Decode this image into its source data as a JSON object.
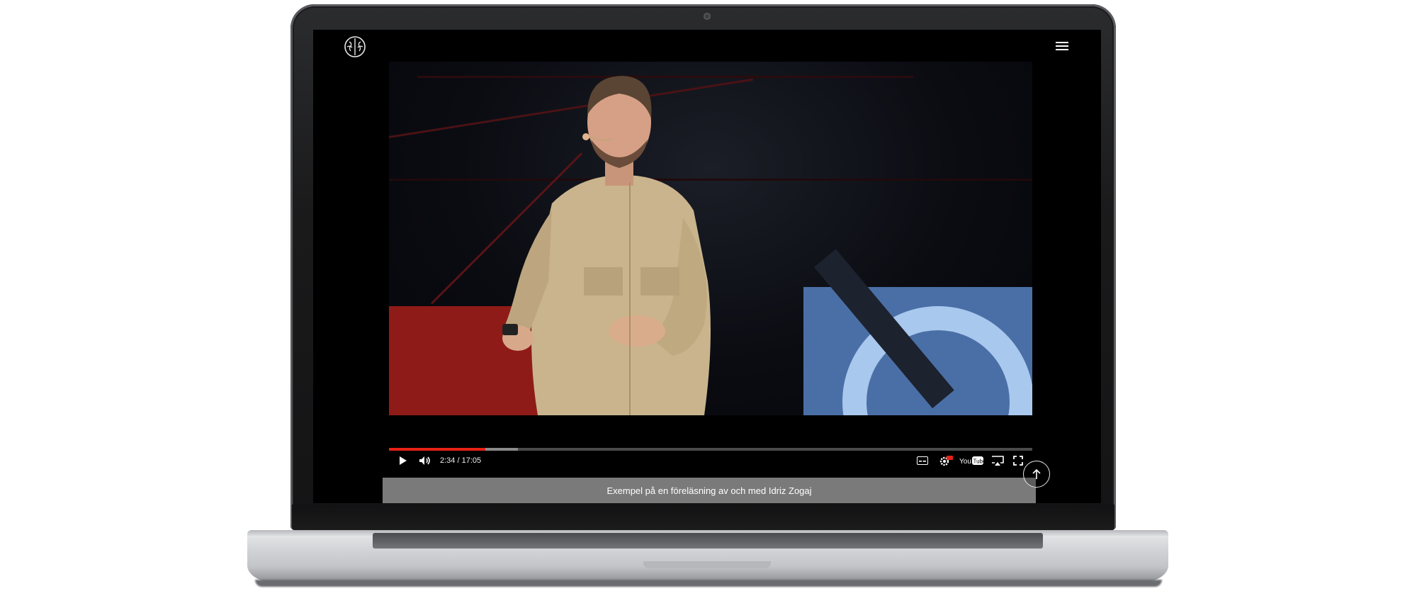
{
  "player": {
    "current_time": "2:34",
    "duration": "17:05",
    "time_display": "2:34 / 17:05",
    "progress_fraction": 0.15,
    "buffered_fraction": 0.2,
    "youtube_label": "YouTube"
  },
  "caption": {
    "text": "Exempel på en föreläsning av och med Idriz Zogaj"
  },
  "icons": {
    "logo": "brain-icon",
    "menu": "hamburger-menu-icon",
    "play": "play-icon",
    "volume": "volume-icon",
    "subtitles": "subtitles-icon",
    "settings": "settings-gear-icon",
    "youtube": "youtube-logo-icon",
    "airplay": "airplay-icon",
    "fullscreen": "fullscreen-icon",
    "scroll_top": "arrow-up-icon"
  },
  "colors": {
    "progress_played": "#e62117",
    "progress_buffered": "#8a8a8a",
    "caption_bar": "#7a7a7a",
    "screen_bg": "#000000"
  }
}
